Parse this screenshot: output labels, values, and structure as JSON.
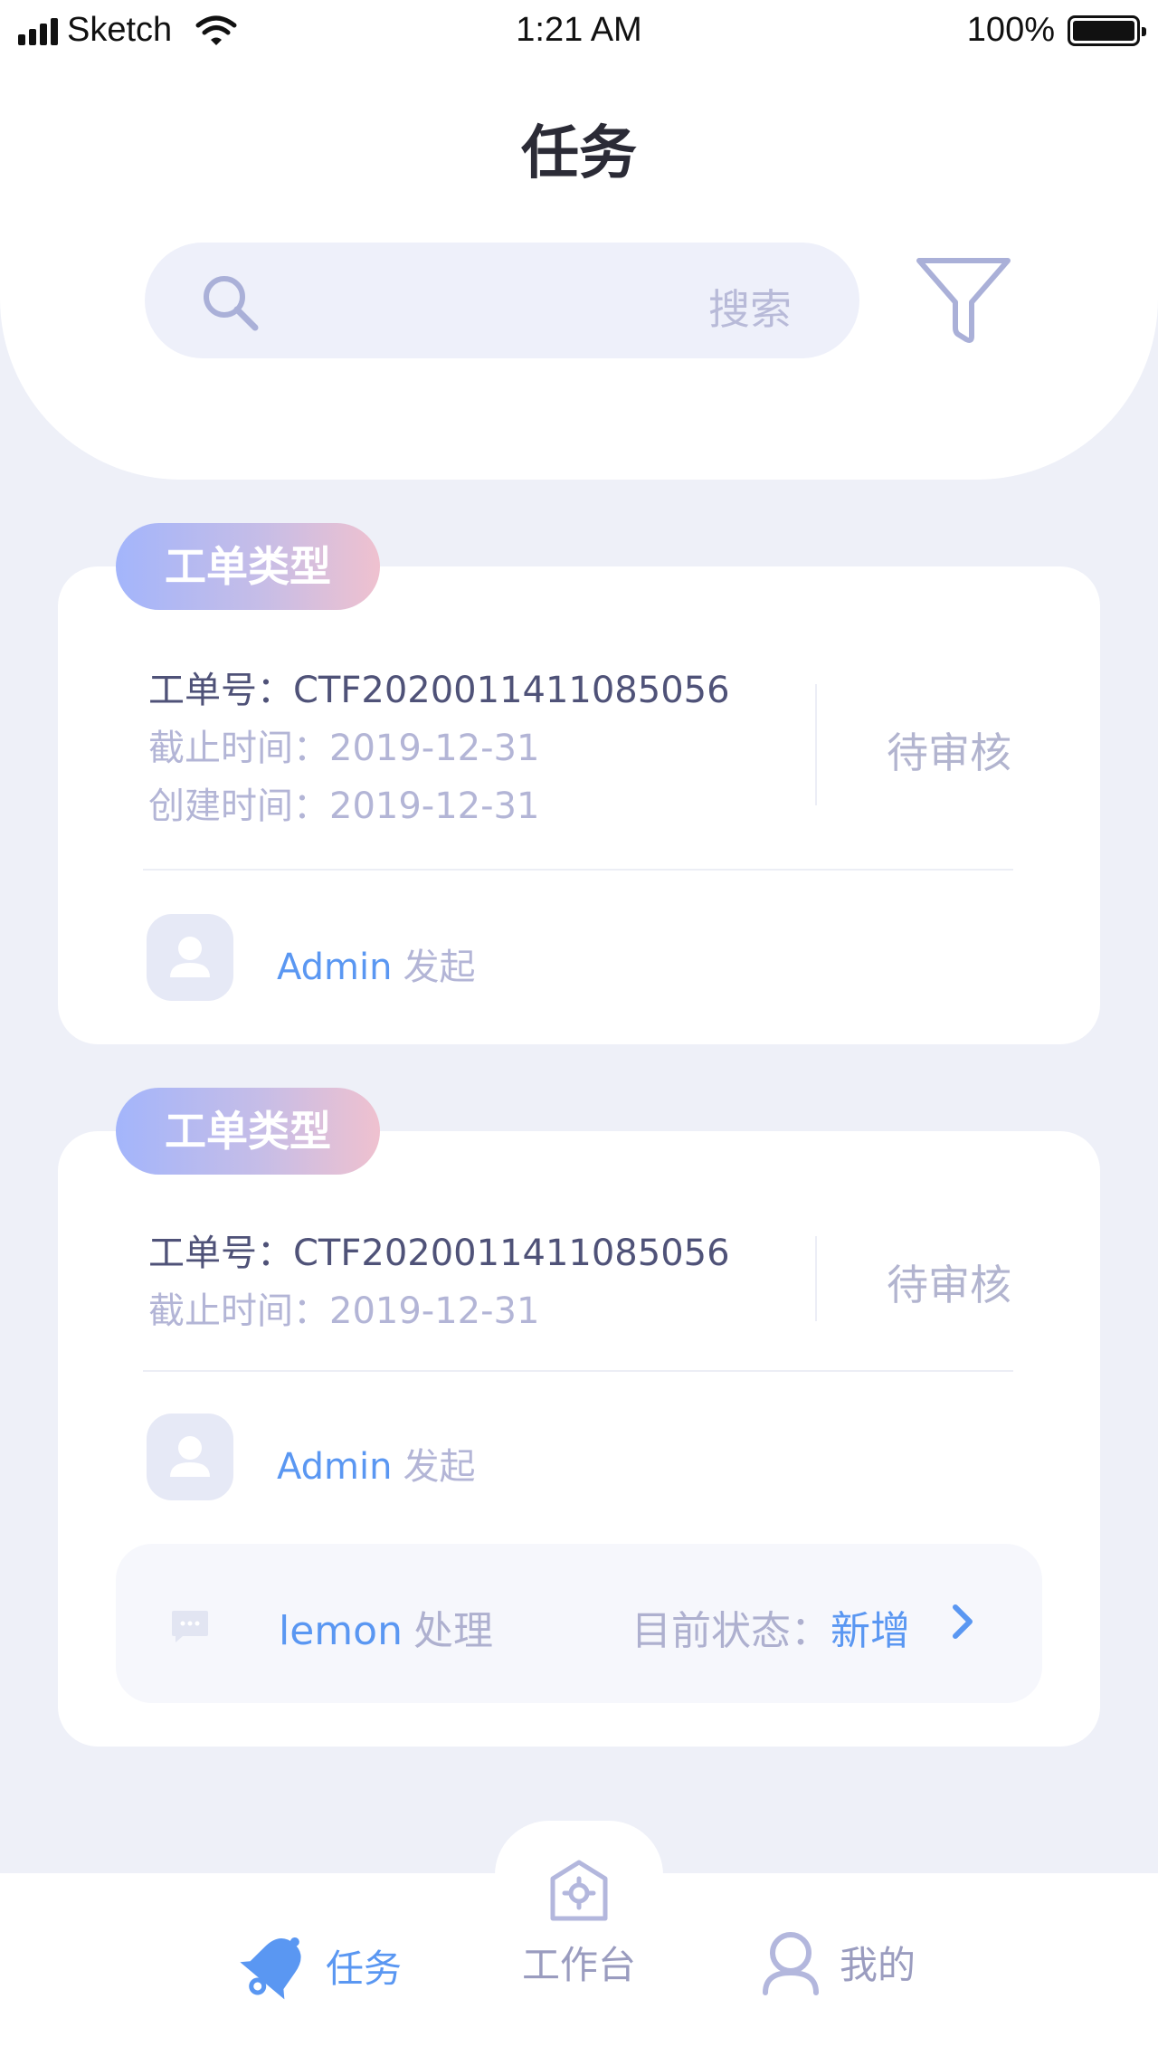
{
  "status_bar": {
    "carrier": "Sketch",
    "time": "1:21 AM",
    "battery": "100%"
  },
  "header": {
    "title": "任务",
    "search_placeholder": "搜索"
  },
  "cards": [
    {
      "type_badge": "工单类型",
      "order_no": "工单号：CTF2020011411085056",
      "deadline": "截止时间：2019-12-31",
      "created": "创建时间：2019-12-31",
      "status": "待审核",
      "initiator_name": "Admin",
      "initiator_action": "发起"
    },
    {
      "type_badge": "工单类型",
      "order_no": "工单号：CTF2020011411085056",
      "deadline": "截止时间：2019-12-31",
      "status": "待审核",
      "initiator_name": "Admin",
      "initiator_action": "发起",
      "process": {
        "handler_name": "lemon",
        "handler_action": "处理",
        "state_label": "目前状态：",
        "state_value": "新增"
      }
    }
  ],
  "tabbar": {
    "task": "任务",
    "workbench": "工作台",
    "mine": "我的"
  },
  "colors": {
    "accent": "#5a97f2",
    "background": "#eef0f8",
    "muted_text": "#b3b5d6",
    "badge_gradient_start": "#a3b5fb",
    "badge_gradient_end": "#efc1cf"
  },
  "icons": [
    "signal-icon",
    "wifi-icon",
    "battery-icon",
    "search-icon",
    "filter-icon",
    "avatar-icon",
    "message-icon",
    "chevron-right-icon",
    "bell-icon",
    "workbench-icon",
    "user-icon"
  ]
}
